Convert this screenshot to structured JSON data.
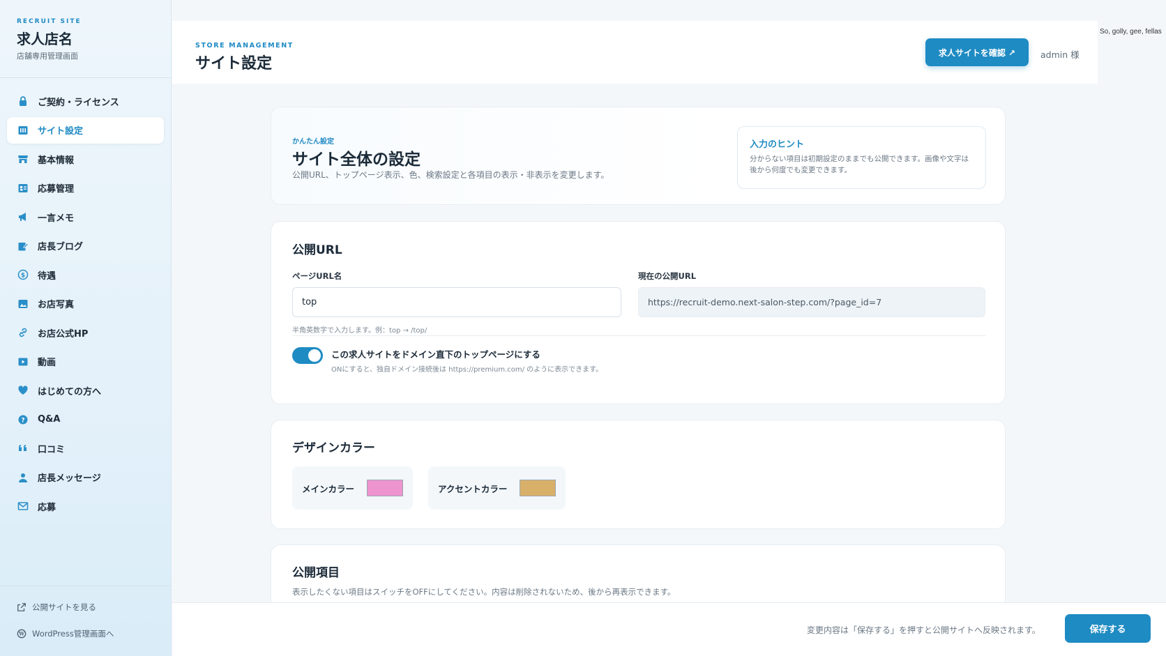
{
  "sidebar": {
    "brand_kicker": "RECRUIT SITE",
    "brand_name": "求人店名",
    "brand_sub": "店舗専用管理画面",
    "items": [
      {
        "label": "ご契約・ライセンス",
        "icon": "lock-icon"
      },
      {
        "label": "サイト設定",
        "icon": "settings-panel-icon",
        "active": true
      },
      {
        "label": "基本情報",
        "icon": "store-icon"
      },
      {
        "label": "応募管理",
        "icon": "contact-card-icon"
      },
      {
        "label": "一言メモ",
        "icon": "megaphone-icon"
      },
      {
        "label": "店長ブログ",
        "icon": "edit-note-icon"
      },
      {
        "label": "待遇",
        "icon": "dollar-circle-icon"
      },
      {
        "label": "お店写真",
        "icon": "photo-icon"
      },
      {
        "label": "お店公式HP",
        "icon": "link-icon"
      },
      {
        "label": "動画",
        "icon": "video-play-icon"
      },
      {
        "label": "はじめての方へ",
        "icon": "heart-icon"
      },
      {
        "label": "Q&A",
        "icon": "question-circle-icon"
      },
      {
        "label": "口コミ",
        "icon": "quote-icon"
      },
      {
        "label": "店長メッセージ",
        "icon": "person-icon"
      },
      {
        "label": "応募",
        "icon": "mail-icon"
      }
    ],
    "footer_links": [
      {
        "label": "公開サイトを見る",
        "icon": "external-link-icon"
      },
      {
        "label": "WordPress管理画面へ",
        "icon": "wordpress-icon"
      }
    ]
  },
  "header": {
    "kicker": "STORE MANAGEMENT",
    "title": "サイト設定",
    "view_button": "求人サイトを確認 ↗",
    "admin": "admin 様"
  },
  "corner_text": "So, golly, gee, fellas",
  "intro": {
    "kicker": "かんたん設定",
    "title": "サイト全体の設定",
    "description": "公開URL、トップページ表示、色、検索設定と各項目の表示・非表示を変更します。",
    "hint_title": "入力のヒント",
    "hint_body": "分からない項目は初期設定のままでも公開できます。画像や文字は後から何度でも変更できます。"
  },
  "public_url": {
    "title": "公開URL",
    "page_url_label": "ページURL名",
    "page_url_value": "top",
    "page_url_help": "半角英数字で入力します。例：top → /top/",
    "current_url_label": "現在の公開URL",
    "current_url_value": "https://recruit-demo.next-salon-step.com/?page_id=7",
    "toggle_label": "この求人サイトをドメイン直下のトップページにする",
    "toggle_sub": "ONにすると、独自ドメイン接続後は https://premium.com/ のように表示できます。",
    "toggle_on": true
  },
  "design_color": {
    "title": "デザインカラー",
    "main_label": "メインカラー",
    "main_color": "#ee94cf",
    "accent_label": "アクセントカラー",
    "accent_color": "#d9b06a"
  },
  "public_items": {
    "title": "公開項目",
    "description": "表示したくない項目はスイッチをOFFにしてください。内容は削除されないため、後から再表示できます。"
  },
  "footer": {
    "message": "変更内容は「保存する」を押すと公開サイトへ反映されます。",
    "save_button": "保存する"
  },
  "colors": {
    "accent": "#1e8bc3",
    "text": "#1b2a38"
  }
}
